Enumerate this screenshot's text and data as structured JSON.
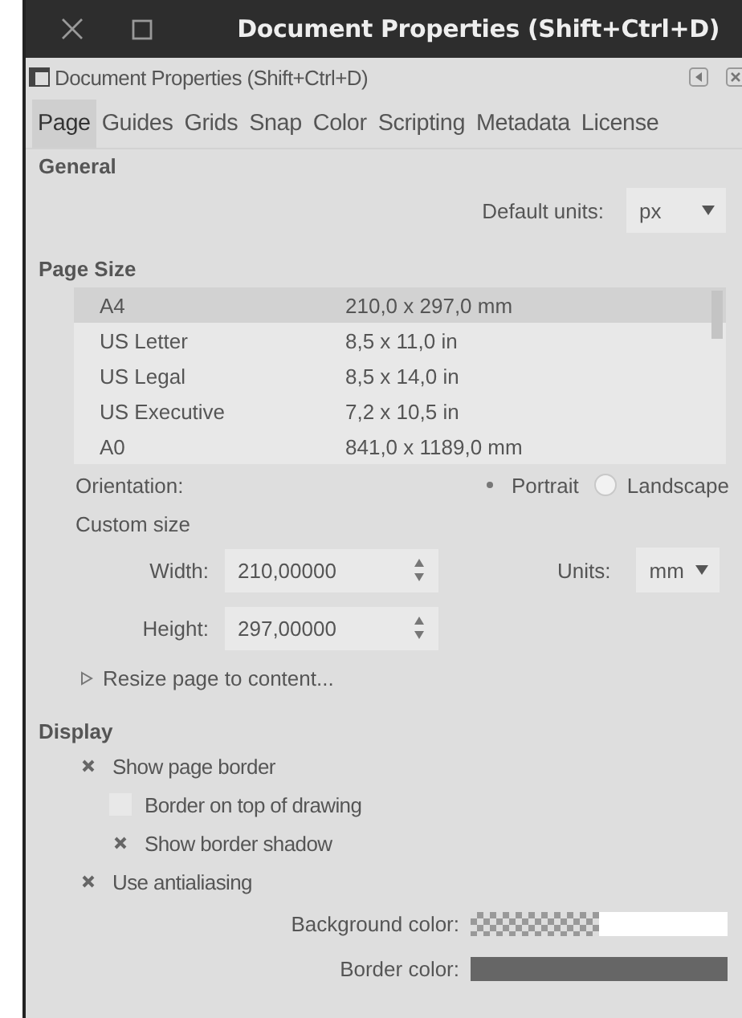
{
  "window": {
    "title": "Document Properties (Shift+Ctrl+D)"
  },
  "dock": {
    "title": "Document Properties (Shift+Ctrl+D)"
  },
  "tabs": [
    {
      "label": "Page",
      "selected": true
    },
    {
      "label": "Guides",
      "selected": false
    },
    {
      "label": "Grids",
      "selected": false
    },
    {
      "label": "Snap",
      "selected": false
    },
    {
      "label": "Color",
      "selected": false
    },
    {
      "label": "Scripting",
      "selected": false
    },
    {
      "label": "Metadata",
      "selected": false
    },
    {
      "label": "License",
      "selected": false
    }
  ],
  "general": {
    "heading": "General",
    "default_units": {
      "label": "Default units:",
      "value": "px"
    }
  },
  "page_size": {
    "heading": "Page Size",
    "sizes": [
      {
        "name": "A4",
        "dimensions": "210,0 x 297,0 mm",
        "selected": true
      },
      {
        "name": "US Letter",
        "dimensions": "8,5 x 11,0 in",
        "selected": false
      },
      {
        "name": "US Legal",
        "dimensions": "8,5 x 14,0 in",
        "selected": false
      },
      {
        "name": "US Executive",
        "dimensions": "7,2 x 10,5 in",
        "selected": false
      },
      {
        "name": "A0",
        "dimensions": "841,0 x 1189,0 mm",
        "selected": false
      }
    ],
    "orientation": {
      "label": "Orientation:",
      "options": [
        {
          "label": "Portrait",
          "selected": true
        },
        {
          "label": "Landscape",
          "selected": false
        }
      ]
    },
    "custom_size": {
      "heading": "Custom size",
      "fields": [
        {
          "label": "Width:",
          "value": "210,00000"
        },
        {
          "label": "Height:",
          "value": "297,00000"
        }
      ],
      "units": {
        "label": "Units:",
        "value": "mm"
      }
    },
    "resize": {
      "label": "Resize page to content...",
      "expanded": false
    }
  },
  "display": {
    "heading": "Display",
    "options": [
      {
        "label": "Show page border",
        "checked": true,
        "children": [
          {
            "label": "Border on top of drawing",
            "checked": false
          },
          {
            "label": "Show border shadow",
            "checked": true
          }
        ]
      },
      {
        "label": "Use antialiasing",
        "checked": true
      }
    ],
    "colors": [
      {
        "label": "Background color:",
        "color": "#ffffff",
        "checkered": true
      },
      {
        "label": "Border color:",
        "color": "#666666",
        "checkered": false
      }
    ]
  }
}
